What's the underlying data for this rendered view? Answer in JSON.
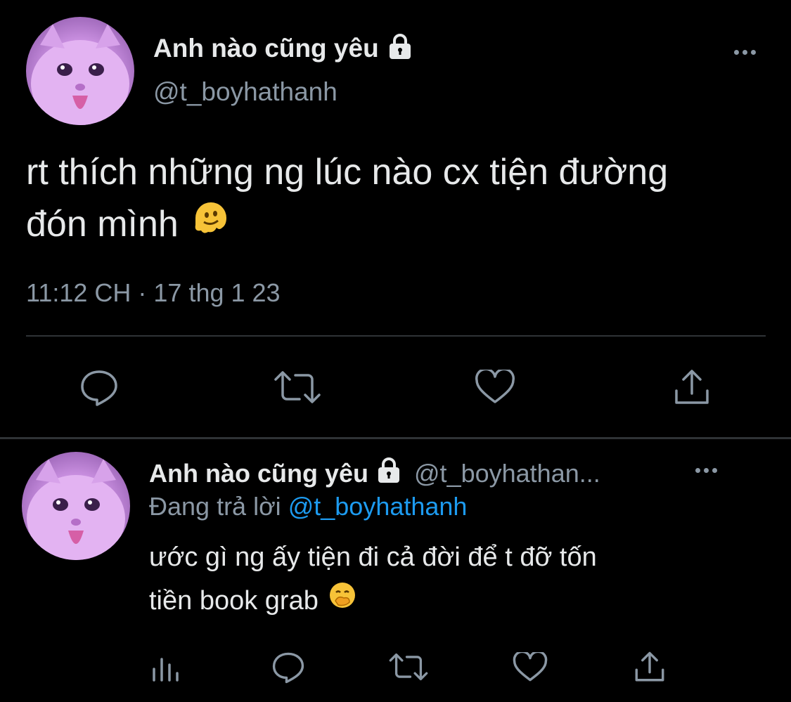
{
  "main_tweet": {
    "display_name": "Anh nào cũng yêu",
    "handle": "@t_boyhathanh",
    "text_line1": "rt thích những ng lúc nào cx tiện đường",
    "text_line2": "đón mình",
    "emoji": "melting-face",
    "timestamp": "11:12 CH · 17 thg 1 23",
    "actions": [
      "reply-icon",
      "retweet-icon",
      "like-icon",
      "share-icon"
    ]
  },
  "reply_tweet": {
    "display_name": "Anh nào cũng yêu",
    "handle": "@t_boyhathan...",
    "replying_prefix": "Đang trả lời",
    "replying_to": "@t_boyhathanh",
    "text_line1": "ước gì ng ấy tiện đi cả đời để t đỡ tốn",
    "text_line2": "tiền book grab",
    "emoji": "face-with-hand-over-mouth",
    "actions": [
      "analytics-icon",
      "reply-icon",
      "retweet-icon",
      "like-icon",
      "share-icon"
    ]
  },
  "colors": {
    "background": "#000000",
    "text": "#e7e9ea",
    "secondary": "#8b98a5",
    "link": "#1d9bf0",
    "divider": "#2f3336"
  }
}
